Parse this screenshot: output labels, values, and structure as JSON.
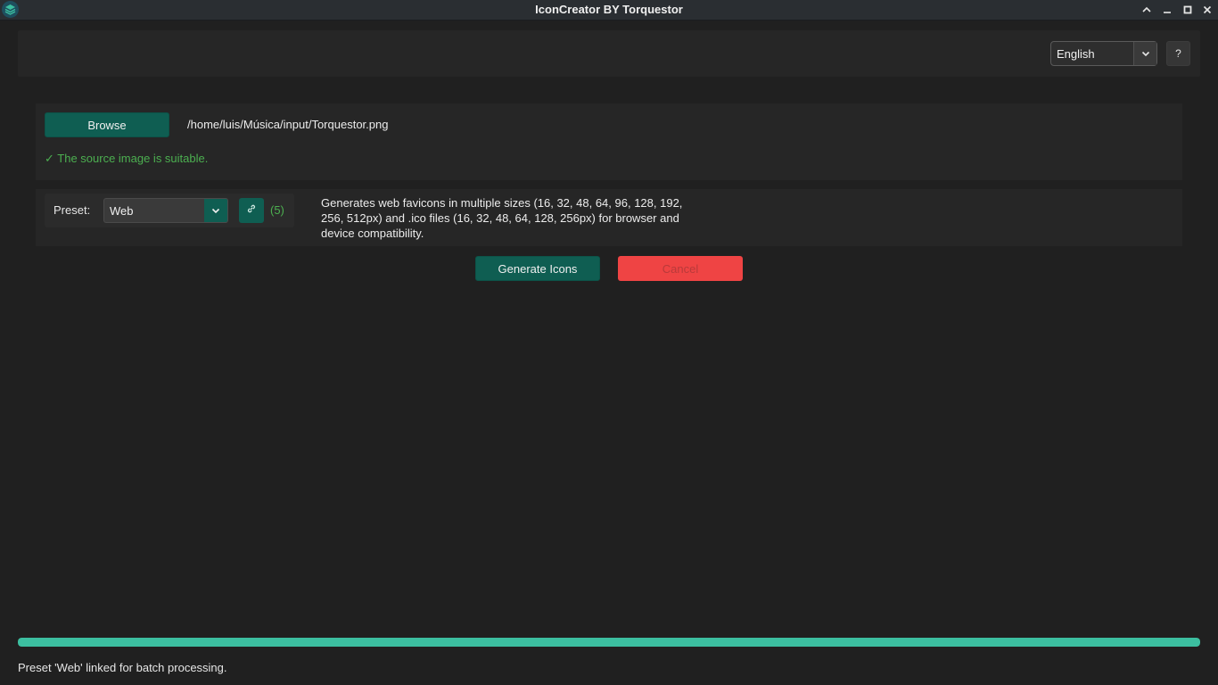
{
  "window": {
    "title": "IconCreator BY Torquestor",
    "app_icon": "layers-icon",
    "controls": [
      "chevron-up-icon",
      "minimize-icon",
      "maximize-icon",
      "close-icon"
    ]
  },
  "toolbar": {
    "language": "English",
    "help_label": "?"
  },
  "source": {
    "browse_label": "Browse",
    "path": "/home/luis/Música/input/Torquestor.png",
    "status": "✓ The source image is suitable."
  },
  "preset": {
    "label": "Preset:",
    "selected": "Web",
    "link_icon": "link-icon",
    "linked_count": "(5)",
    "description": "Generates web favicons in multiple sizes (16, 32, 48, 64, 96, 128, 192, 256, 512px) and .ico files (16, 32, 48, 64, 128, 256px) for browser and device compatibility."
  },
  "actions": {
    "generate_label": "Generate Icons",
    "cancel_label": "Cancel"
  },
  "progress": {
    "value_percent": 100
  },
  "status_bar": {
    "message": "Preset 'Web' linked for batch processing."
  },
  "colors": {
    "accent": "#0f5e52",
    "success": "#4caf50",
    "danger": "#ef4444",
    "progress": "#3cbfa0",
    "background": "#202020"
  }
}
